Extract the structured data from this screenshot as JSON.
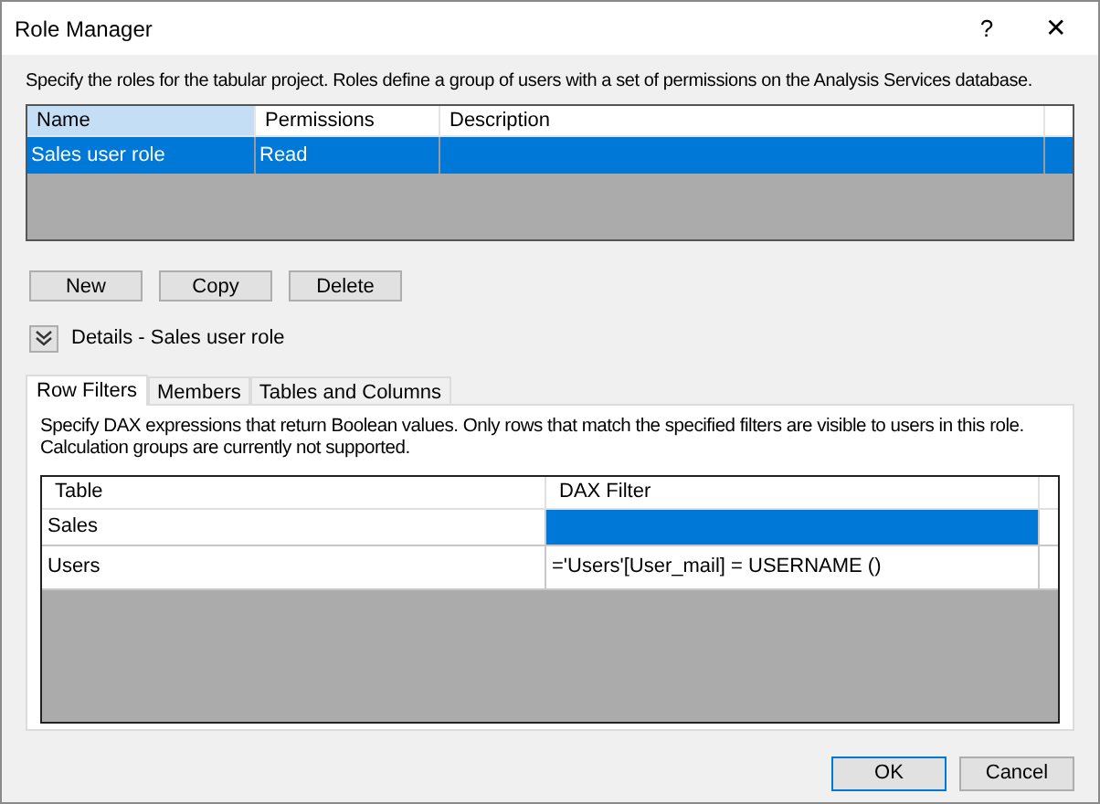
{
  "window": {
    "title": "Role Manager",
    "help": "?",
    "close": "✕"
  },
  "intro": "Specify the roles for the tabular project. Roles define a group of users with a set of permissions on the Analysis Services database.",
  "roles": {
    "columns": [
      {
        "label": "Name",
        "highlighted": true
      },
      {
        "label": "Permissions",
        "highlighted": false
      },
      {
        "label": "Description",
        "highlighted": false
      }
    ],
    "rows": [
      {
        "cells": [
          "Sales user role",
          "Read",
          ""
        ],
        "selected": true
      }
    ]
  },
  "role_buttons": [
    "New",
    "Copy",
    "Delete"
  ],
  "details": {
    "label": "Details - Sales user role",
    "expanded": true
  },
  "tabs": [
    {
      "label": "Row Filters",
      "selected": true
    },
    {
      "label": "Members",
      "selected": false
    },
    {
      "label": "Tables and Columns",
      "selected": false
    }
  ],
  "row_filters": {
    "description": "Specify DAX expressions that return Boolean values. Only rows that match the specified filters are visible to users in this role. Calculation groups are currently not supported.",
    "columns": [
      "Table",
      "DAX Filter"
    ],
    "rows": [
      {
        "table": "Sales",
        "filter": "",
        "selected": true
      },
      {
        "table": "Users",
        "filter": "='Users'[User_mail]  = USERNAME ()",
        "selected": false
      }
    ]
  },
  "buttons": [
    {
      "label": "OK",
      "default": true
    },
    {
      "label": "Cancel",
      "default": false
    }
  ]
}
